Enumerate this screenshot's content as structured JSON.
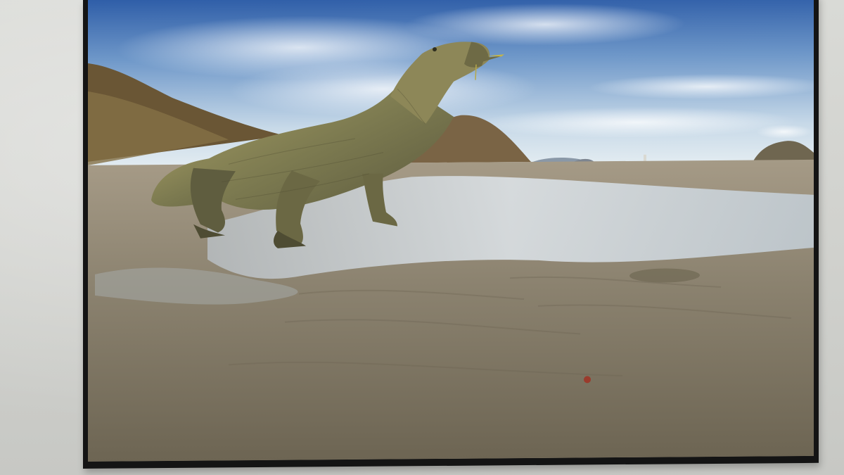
{
  "scene": {
    "subject": "",
    "palette": {
      "wall": "#d5d6d2",
      "frame": "#141414",
      "sky_top": "#3b6db7",
      "sky_bottom": "#dbe7ee",
      "sand": "#8d8471",
      "water": "#c9d3dc",
      "lizard": "#7b7a52",
      "hill": "#6b5838"
    }
  }
}
